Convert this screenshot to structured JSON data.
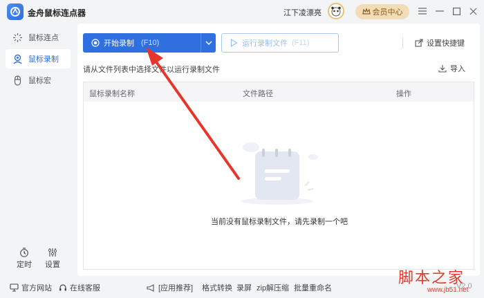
{
  "app": {
    "title": "金舟鼠标连点器",
    "user_name": "江下凌漂亮",
    "member_label": "会员中心"
  },
  "sidebar": {
    "items": [
      {
        "label": "鼠标连点",
        "icon": "click-burst-icon"
      },
      {
        "label": "鼠标录制",
        "icon": "record-user-icon"
      },
      {
        "label": "鼠标宏",
        "icon": "mouse-icon"
      }
    ],
    "bottom": [
      {
        "label": "定时",
        "icon": "timer-icon"
      },
      {
        "label": "设置",
        "icon": "sliders-icon"
      }
    ]
  },
  "toolbar": {
    "start_label": "开始录制",
    "start_hotkey": "(F10)",
    "run_label": "运行录制文件",
    "run_hotkey": "(F11)",
    "shortcut_label": "设置快捷键"
  },
  "main": {
    "hint": "请从文件列表中选择文件以运行录制文件",
    "import_label": "导入",
    "columns": [
      "鼠标录制名称",
      "文件路径",
      "操作"
    ],
    "empty_text": "当前没有鼠标录制文件，请先录制一个吧"
  },
  "footer": {
    "website": "官方网站",
    "support": "在线客服",
    "recommend": "[应用推荐]",
    "links": [
      "格式转换",
      "录屏",
      "zip解压缩",
      "批量重命名"
    ],
    "version": "V2.0"
  },
  "watermark": {
    "big": "脚本之家",
    "small": "www.jb51.net"
  },
  "colors": {
    "accent": "#2f6fe0",
    "annotation_arrow": "#e8352b"
  }
}
